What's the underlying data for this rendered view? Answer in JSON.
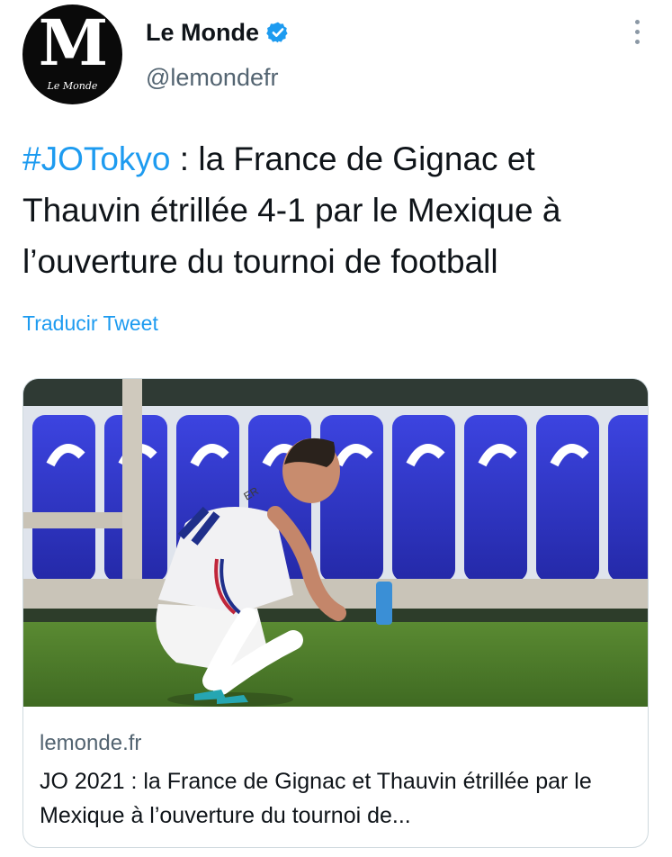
{
  "account": {
    "display_name": "Le Monde",
    "handle": "@lemondefr",
    "avatar_letter": "M",
    "avatar_wordmark": "Le Monde",
    "verified": true
  },
  "tweet": {
    "hashtag": "#JOTokyo",
    "text": " : la France de Gignac et Thauvin étrillée 4-1 par le Mexique à l’ouverture du tournoi de football",
    "translate_label": "Traducir Tweet"
  },
  "link_card": {
    "domain": "lemonde.fr",
    "title": "JO 2021 : la France de Gignac et Thauvin étrillée par le Mexique à l’ouverture du tournoi de...",
    "jersey_text": "ER"
  },
  "icons": {
    "verified": "verified-badge-icon",
    "more": "more-options-icon"
  },
  "colors": {
    "accent": "#1d9bf0",
    "text_primary": "#0f1419",
    "text_secondary": "#536471",
    "border": "#cfd9de",
    "seat_blue": "#2f36c9",
    "grass": "#4f7a2a"
  }
}
